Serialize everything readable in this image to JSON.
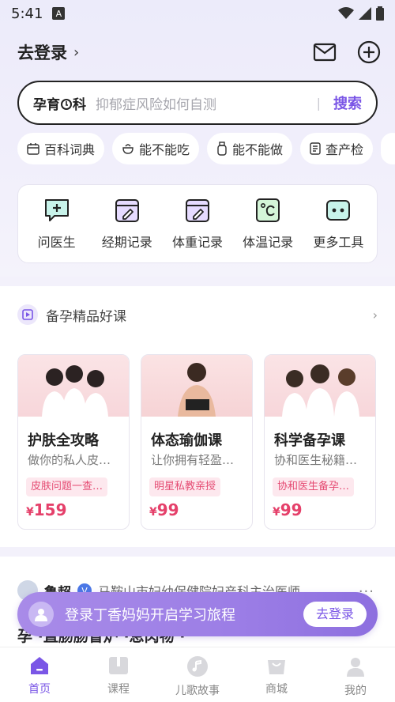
{
  "status_bar": {
    "time": "5:41",
    "a_glyph": "A"
  },
  "header": {
    "login_label": "去登录",
    "chevron": "›"
  },
  "search": {
    "brand_prefix": "孕育",
    "brand_suffix": "科",
    "placeholder": "抑郁症风险如何自测",
    "divider": "|",
    "button_label": "搜索"
  },
  "chips": [
    {
      "label": "百科词典",
      "icon": "calendar-icon"
    },
    {
      "label": "能不能吃",
      "icon": "bowl-icon"
    },
    {
      "label": "能不能做",
      "icon": "bottle-icon"
    },
    {
      "label": "查产检",
      "icon": "report-icon"
    }
  ],
  "tools": [
    {
      "label": "问医生",
      "icon": "chat-cross-icon"
    },
    {
      "label": "经期记录",
      "icon": "calendar-pen-icon"
    },
    {
      "label": "体重记录",
      "icon": "calendar-pen-icon"
    },
    {
      "label": "体温记录",
      "icon": "thermometer-icon"
    },
    {
      "label": "更多工具",
      "icon": "more-tools-icon"
    }
  ],
  "courses": {
    "section_title": "备孕精品好课",
    "chevron": "›",
    "items": [
      {
        "title": "护肤全攻略",
        "subtitle": "做你的私人皮…",
        "tag": "皮肤问题一查…",
        "price_symbol": "¥",
        "price": "159"
      },
      {
        "title": "体态瑜伽课",
        "subtitle": "让你拥有轻盈…",
        "tag": "明星私教亲授",
        "price_symbol": "¥",
        "price": "99"
      },
      {
        "title": "科学备孕课",
        "subtitle": "协和医生秘籍…",
        "tag": "协和医生备孕…",
        "price_symbol": "¥",
        "price": "99"
      }
    ]
  },
  "feed": {
    "author": "鲁超",
    "verified": "V",
    "role": "马鞍山市妇幼保健院妇产科主治医师",
    "more": "···",
    "text": "孕 ·直肠肠冒炉 ·息肉物 ·"
  },
  "login_banner": {
    "text": "登录丁香妈妈开启学习旅程",
    "button_label": "去登录"
  },
  "bottom_nav": [
    {
      "label": "首页",
      "icon": "home-icon",
      "active": true
    },
    {
      "label": "课程",
      "icon": "book-icon",
      "active": false
    },
    {
      "label": "儿歌故事",
      "icon": "music-icon",
      "active": false
    },
    {
      "label": "商城",
      "icon": "shop-bag-icon",
      "active": false
    },
    {
      "label": "我的",
      "icon": "person-icon",
      "active": false
    }
  ],
  "colors": {
    "accent": "#7a56e6",
    "price": "#e5406a",
    "tag_bg": "#fde8ee"
  }
}
